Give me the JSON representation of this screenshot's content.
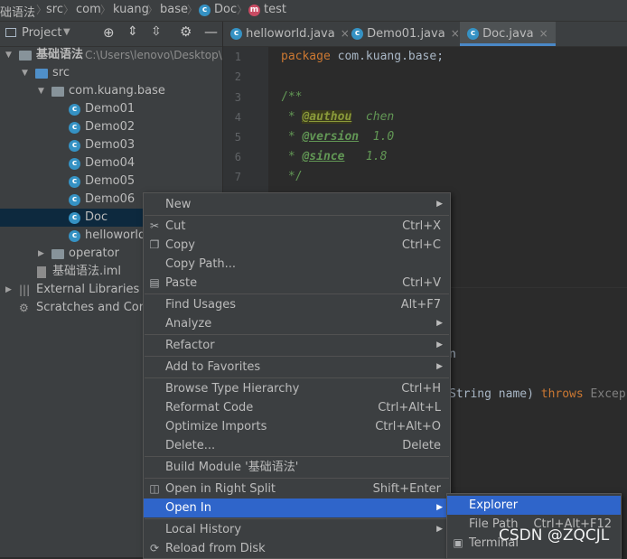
{
  "breadcrumb": {
    "items": [
      "础语法",
      "src",
      "com",
      "kuang",
      "base",
      "Doc",
      "test"
    ],
    "doc_icon": "class-icon",
    "test_icon": "method-icon"
  },
  "project": {
    "title": "Project",
    "root_name": "基础语法",
    "root_path": "C:\\Users\\lenovo\\Desktop\\",
    "tree": {
      "src": "src",
      "package": "com.kuang.base",
      "classes": [
        "Demo01",
        "Demo02",
        "Demo03",
        "Demo04",
        "Demo05",
        "Demo06",
        "Doc",
        "helloworld"
      ],
      "operator": "operator",
      "iml": "基础语法.iml",
      "external": "External Libraries",
      "scratches": "Scratches and Conso"
    }
  },
  "tabs": [
    {
      "label": "helloworld.java",
      "close": "×"
    },
    {
      "label": "Demo01.java",
      "close": "×"
    },
    {
      "label": "Doc.java",
      "close": "×"
    }
  ],
  "editor": {
    "line_numbers": [
      "1",
      "2",
      "3",
      "4",
      "5",
      "6",
      "7"
    ],
    "line1_kw": "package",
    "line1_rest": " com.kuang.base;",
    "line3": "/**",
    "line4_tag": "@authou",
    "line4_val": "  chen",
    "line5_tag": "@version",
    "line5_val": "  1.0",
    "line6_tag": "@since",
    "line6_val": "   1.8",
    "line7": " */",
    "lower_fragment_1": "n",
    "lower_fragment_2": "String name) ",
    "lower_throws": "throws",
    "lower_excep": " Excep"
  },
  "context_menu": {
    "items": [
      {
        "label": "New",
        "shortcut": "",
        "submenu": true
      },
      {
        "label": "Cut",
        "shortcut": "Ctrl+X",
        "icon": "cut-icon"
      },
      {
        "label": "Copy",
        "shortcut": "Ctrl+C",
        "icon": "copy-icon"
      },
      {
        "label": "Copy Path...",
        "shortcut": ""
      },
      {
        "label": "Paste",
        "shortcut": "Ctrl+V",
        "icon": "paste-icon"
      },
      {
        "label": "Find Usages",
        "shortcut": "Alt+F7"
      },
      {
        "label": "Analyze",
        "shortcut": "",
        "submenu": true
      },
      {
        "label": "Refactor",
        "shortcut": "",
        "submenu": true
      },
      {
        "label": "Add to Favorites",
        "shortcut": "",
        "submenu": true
      },
      {
        "label": "Browse Type Hierarchy",
        "shortcut": "Ctrl+H"
      },
      {
        "label": "Reformat Code",
        "shortcut": "Ctrl+Alt+L"
      },
      {
        "label": "Optimize Imports",
        "shortcut": "Ctrl+Alt+O"
      },
      {
        "label": "Delete...",
        "shortcut": "Delete"
      },
      {
        "label": "Build Module '基础语法'",
        "shortcut": ""
      },
      {
        "label": "Open in Right Split",
        "shortcut": "Shift+Enter",
        "icon": "split-icon"
      },
      {
        "label": "Open In",
        "shortcut": "",
        "submenu": true,
        "selected": true
      },
      {
        "label": "Local History",
        "shortcut": "",
        "submenu": true
      },
      {
        "label": "Reload from Disk",
        "shortcut": "",
        "icon": "reload-icon"
      }
    ]
  },
  "submenu": {
    "items": [
      {
        "label": "Explorer",
        "shortcut": "",
        "selected": true
      },
      {
        "label": "File Path",
        "shortcut": "Ctrl+Alt+F12"
      },
      {
        "label": "Terminal",
        "shortcut": "",
        "icon": "terminal-icon"
      }
    ]
  },
  "watermark": "CSDN @ZQCJL",
  "colors": {
    "accent": "#2f65ca",
    "panel": "#3c3f41",
    "editor": "#2b2b2b",
    "keyword": "#cc7832",
    "comment": "#629755",
    "class_icon": "#3592c4"
  }
}
